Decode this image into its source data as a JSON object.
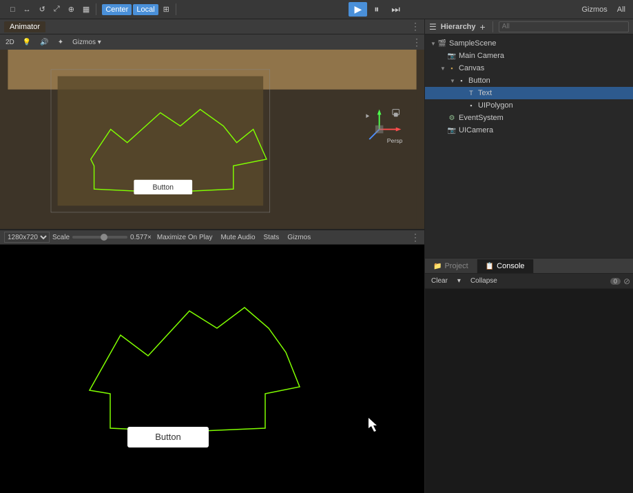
{
  "toolbar": {
    "play_label": "▶",
    "pause_label": "⏸",
    "step_label": "⏭",
    "tools": [
      "□",
      "↔",
      "⊕",
      "↺",
      "⤢",
      "▦"
    ],
    "center_label": "Center",
    "local_label": "Local",
    "grid_label": "⊞",
    "gizmos_label": "Gizmos",
    "all_label": "All"
  },
  "scene_view": {
    "tab_label": "Animator",
    "toolbar_2d": "2D",
    "persp_label": "Persp"
  },
  "game_view": {
    "resolution": "1280x720",
    "scale_label": "Scale",
    "scale_value": "0.577×",
    "maximize_on_play": "Maximize On Play",
    "mute_audio": "Mute Audio",
    "stats_label": "Stats",
    "gizmos_label": "Gizmos"
  },
  "hierarchy": {
    "title": "Hierarchy",
    "search_placeholder": "All",
    "items": [
      {
        "id": "sample-scene",
        "label": "SampleScene",
        "indent": 0,
        "arrow": "▼",
        "icon": "🎬",
        "type": "scene"
      },
      {
        "id": "main-camera",
        "label": "Main Camera",
        "indent": 1,
        "arrow": "",
        "icon": "📷",
        "type": "camera"
      },
      {
        "id": "canvas",
        "label": "Canvas",
        "indent": 1,
        "arrow": "▼",
        "icon": "📋",
        "type": "canvas"
      },
      {
        "id": "button",
        "label": "Button",
        "indent": 2,
        "arrow": "▼",
        "icon": "□",
        "type": "gameobj"
      },
      {
        "id": "text",
        "label": "Text",
        "indent": 3,
        "arrow": "",
        "icon": "T",
        "type": "text"
      },
      {
        "id": "uipolygon",
        "label": "UIPolygon",
        "indent": 3,
        "arrow": "",
        "icon": "□",
        "type": "gameobj"
      },
      {
        "id": "event-system",
        "label": "EventSystem",
        "indent": 1,
        "arrow": "",
        "icon": "⚙",
        "type": "eventsys"
      },
      {
        "id": "ui-camera",
        "label": "UICamera",
        "indent": 1,
        "arrow": "",
        "icon": "📷",
        "type": "camera"
      }
    ]
  },
  "console": {
    "tab_label": "Console",
    "clear_label": "Clear",
    "collapse_label": "Collapse",
    "badge_count": "0"
  },
  "project": {
    "tab_label": "Project"
  },
  "scene_button_label": "Button",
  "game_button_label": "Button"
}
